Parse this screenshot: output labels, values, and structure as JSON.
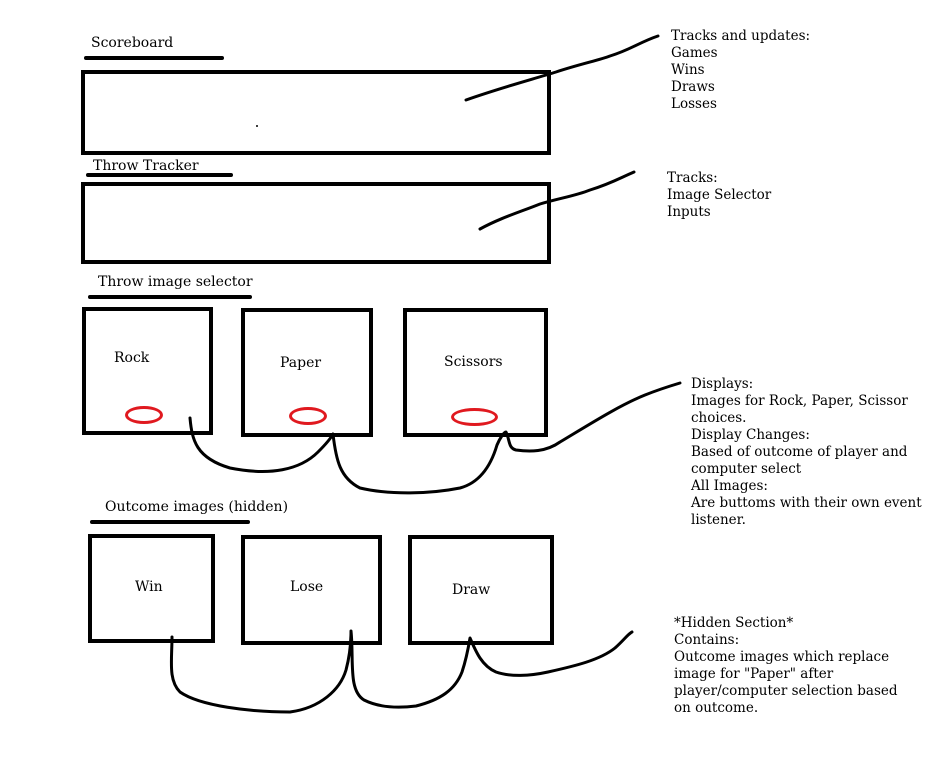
{
  "sections": {
    "scoreboard": {
      "title": "Scoreboard"
    },
    "throw_tracker": {
      "title": "Throw Tracker"
    },
    "throw_selector": {
      "title": "Throw image selector",
      "items": [
        "Rock",
        "Paper",
        "Scissors"
      ]
    },
    "outcome_images": {
      "title": "Outcome images (hidden)",
      "items": [
        "Win",
        "Lose",
        "Draw"
      ]
    }
  },
  "notes": {
    "scoreboard": [
      "Tracks and updates:",
      "Games",
      "Wins",
      "Draws",
      "Losses"
    ],
    "tracker": [
      "Tracks:",
      "Image Selector",
      "Inputs"
    ],
    "selector": [
      "Displays:",
      "Images for Rock, Paper, Scissor",
      "choices.",
      "Display Changes:",
      "Based of outcome of player and",
      "computer select",
      "All Images:",
      "Are buttoms with their own event",
      "listener."
    ],
    "hidden": [
      "*Hidden Section*",
      "Contains:",
      "Outcome images which replace",
      "image for \"Paper\" after",
      "player/computer selection based",
      "on outcome."
    ]
  },
  "colors": {
    "ink": "#000000",
    "marker": "#e0191f"
  }
}
